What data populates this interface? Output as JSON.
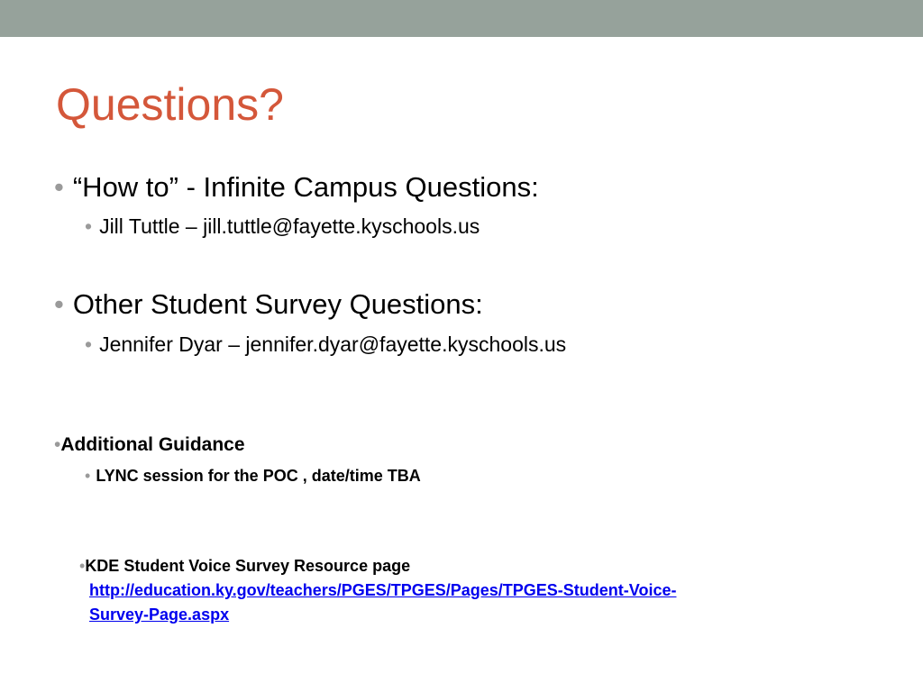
{
  "slide": {
    "title": "Questions?",
    "bullets": [
      {
        "text": "“How to” - Infinite Campus Questions:",
        "sub": "Jill Tuttle – jill.tuttle@fayette.kyschools.us"
      },
      {
        "text": "Other Student Survey Questions:",
        "sub": "Jennifer Dyar – jennifer.dyar@fayette.kyschools.us"
      },
      {
        "text": "Additional Guidance",
        "sub": "LYNC session for the POC , date/time TBA"
      }
    ],
    "resource": {
      "label": "KDE Student Voice Survey Resource page",
      "link_line1": "http://education.ky.gov/teachers/PGES/TPGES/Pages/TPGES-Student-Voice-",
      "link_line2": "Survey-Page.aspx"
    },
    "bullet_glyph": "•"
  },
  "colors": {
    "top_bar": "#96a29b",
    "title": "#d4573a",
    "bullet": "#9a9a9a",
    "link": "#0000ee"
  }
}
